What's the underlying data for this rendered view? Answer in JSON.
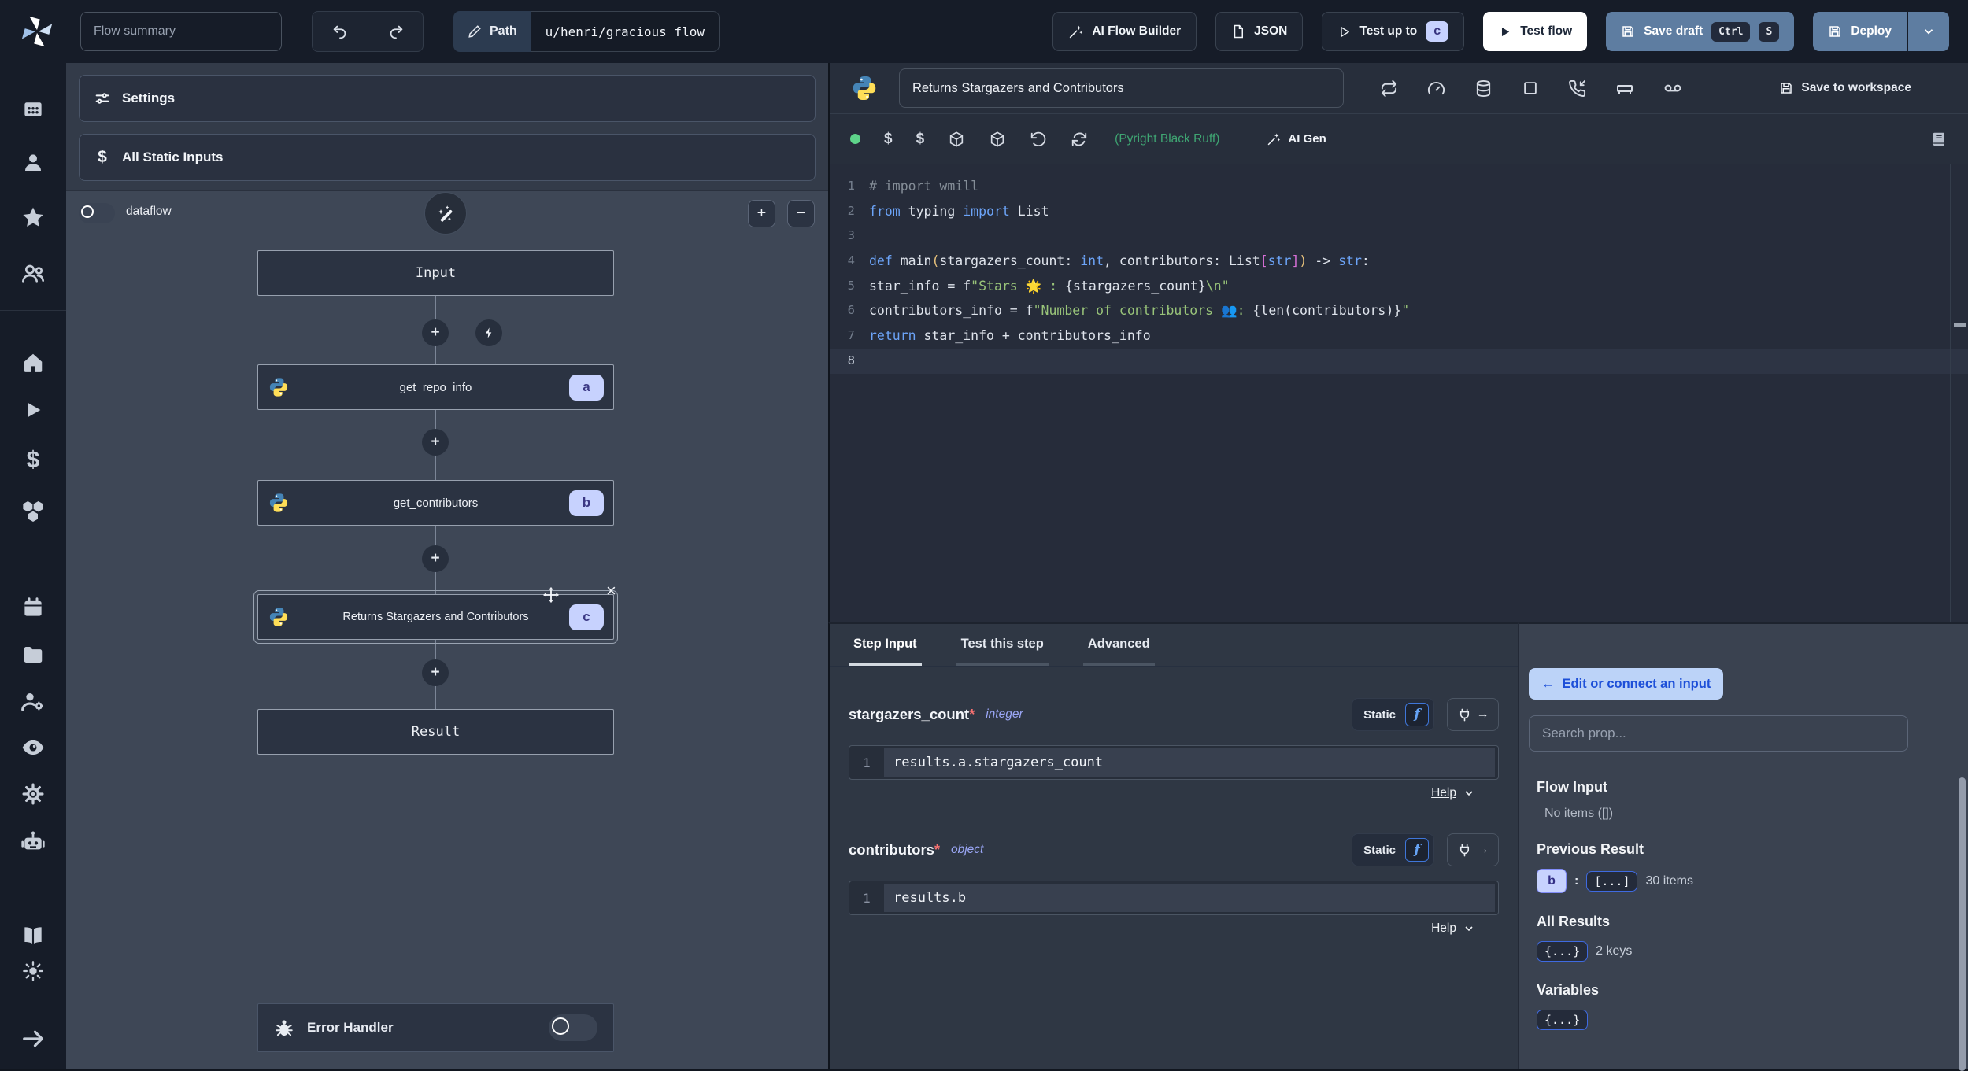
{
  "topbar": {
    "flow_summary_placeholder": "Flow summary",
    "path_label": "Path",
    "path_value": "u/henri/gracious_flow",
    "ai_flow_builder_label": "AI Flow Builder",
    "json_label": "JSON",
    "test_up_to_label": "Test up to",
    "test_up_to_badge": "c",
    "test_flow_label": "Test flow",
    "save_draft_label": "Save draft",
    "kbd_ctrl": "Ctrl",
    "kbd_s": "S",
    "deploy_label": "Deploy"
  },
  "sidebar": {
    "icons": [
      "workspace-icon",
      "user-icon",
      "favorites-star-icon",
      "groups-icon",
      "home-icon",
      "runs-play-icon",
      "variables-dollar-icon",
      "resources-boxes-icon",
      "schedules-calendar-icon",
      "folders-icon",
      "groups-settings-icon",
      "audit-eye-icon",
      "settings-gear-icon",
      "workers-robot-icon",
      "docs-book-icon",
      "theme-sun-icon",
      "expand-arrow-icon"
    ]
  },
  "flow": {
    "settings_label": "Settings",
    "static_inputs_label": "All Static Inputs",
    "dataflow_label": "dataflow",
    "input_node": "Input",
    "result_node": "Result",
    "steps": [
      {
        "id": "a",
        "label": "get_repo_info"
      },
      {
        "id": "b",
        "label": "get_contributors"
      },
      {
        "id": "c",
        "label": "Returns Stargazers and Contributors"
      }
    ],
    "error_handler_label": "Error Handler"
  },
  "editor": {
    "title": "Returns Stargazers and Contributors",
    "save_to_workspace_label": "Save to workspace",
    "lint_label": "(Pyright Black Ruff)",
    "ai_gen_label": "AI Gen",
    "lines": [
      {
        "no": "1",
        "tokens": [
          [
            "cmt",
            "# import wmill"
          ]
        ]
      },
      {
        "no": "2",
        "tokens": [
          [
            "kw",
            "from"
          ],
          [
            "pl",
            " typing "
          ],
          [
            "kw",
            "import"
          ],
          [
            "pl",
            " List"
          ]
        ]
      },
      {
        "no": "3",
        "tokens": []
      },
      {
        "no": "4",
        "tokens": [
          [
            "kw",
            "def"
          ],
          [
            "pl",
            " main"
          ],
          [
            "b1",
            "("
          ],
          [
            "pl",
            "stargazers_count: "
          ],
          [
            "kw",
            "int"
          ],
          [
            "pl",
            ", contributors: List"
          ],
          [
            "b2",
            "["
          ],
          [
            "kw",
            "str"
          ],
          [
            "b2",
            "]"
          ],
          [
            "b1",
            ")"
          ],
          [
            "pl",
            " -> "
          ],
          [
            "kw",
            "str"
          ],
          [
            "pl",
            ":"
          ]
        ]
      },
      {
        "no": "5",
        "tokens": [
          [
            "pl",
            "    star_info = f"
          ],
          [
            "str",
            "\"Stars 🌟 : "
          ],
          [
            "pl",
            "{stargazers_count}"
          ],
          [
            "str",
            "\\n\""
          ]
        ]
      },
      {
        "no": "6",
        "tokens": [
          [
            "pl",
            "    contributors_info = f"
          ],
          [
            "str",
            "\"Number of contributors 👥: "
          ],
          [
            "pl",
            "{len(contributors)}"
          ],
          [
            "str",
            "\""
          ]
        ]
      },
      {
        "no": "7",
        "tokens": [
          [
            "kw",
            "    return"
          ],
          [
            "pl",
            " star_info + contributors_info"
          ]
        ]
      },
      {
        "no": "8",
        "tokens": [],
        "active": true
      }
    ]
  },
  "step_panel": {
    "tabs": [
      "Step Input",
      "Test this step",
      "Advanced"
    ],
    "active_tab": "Step Input",
    "fields": [
      {
        "name": "stargazers_count",
        "required": "*",
        "type": "integer",
        "mode": "Static",
        "line_no": "1",
        "value": "results.a.stargazers_count",
        "help_label": "Help"
      },
      {
        "name": "contributors",
        "required": "*",
        "type": "object",
        "mode": "Static",
        "line_no": "1",
        "value": "results.b",
        "help_label": "Help"
      }
    ]
  },
  "connect_panel": {
    "edit_button_label": "Edit or connect an input",
    "search_placeholder": "Search prop...",
    "flow_input_title": "Flow Input",
    "flow_input_empty": "No items ([])",
    "previous_result_title": "Previous Result",
    "previous_result_badge": "b",
    "previous_result_array_badge": "[...]",
    "previous_result_count": "30 items",
    "all_results_title": "All Results",
    "all_results_badge": "{...}",
    "all_results_count": "2 keys",
    "variables_title": "Variables",
    "variables_badge": "{...}"
  },
  "colors": {
    "accent_blue": "#3b82f6",
    "key_badge_bg": "#c7d2fe",
    "primary_button": "#5e7da1",
    "status_green": "#5ed48a",
    "lint_green": "#3fa673"
  }
}
